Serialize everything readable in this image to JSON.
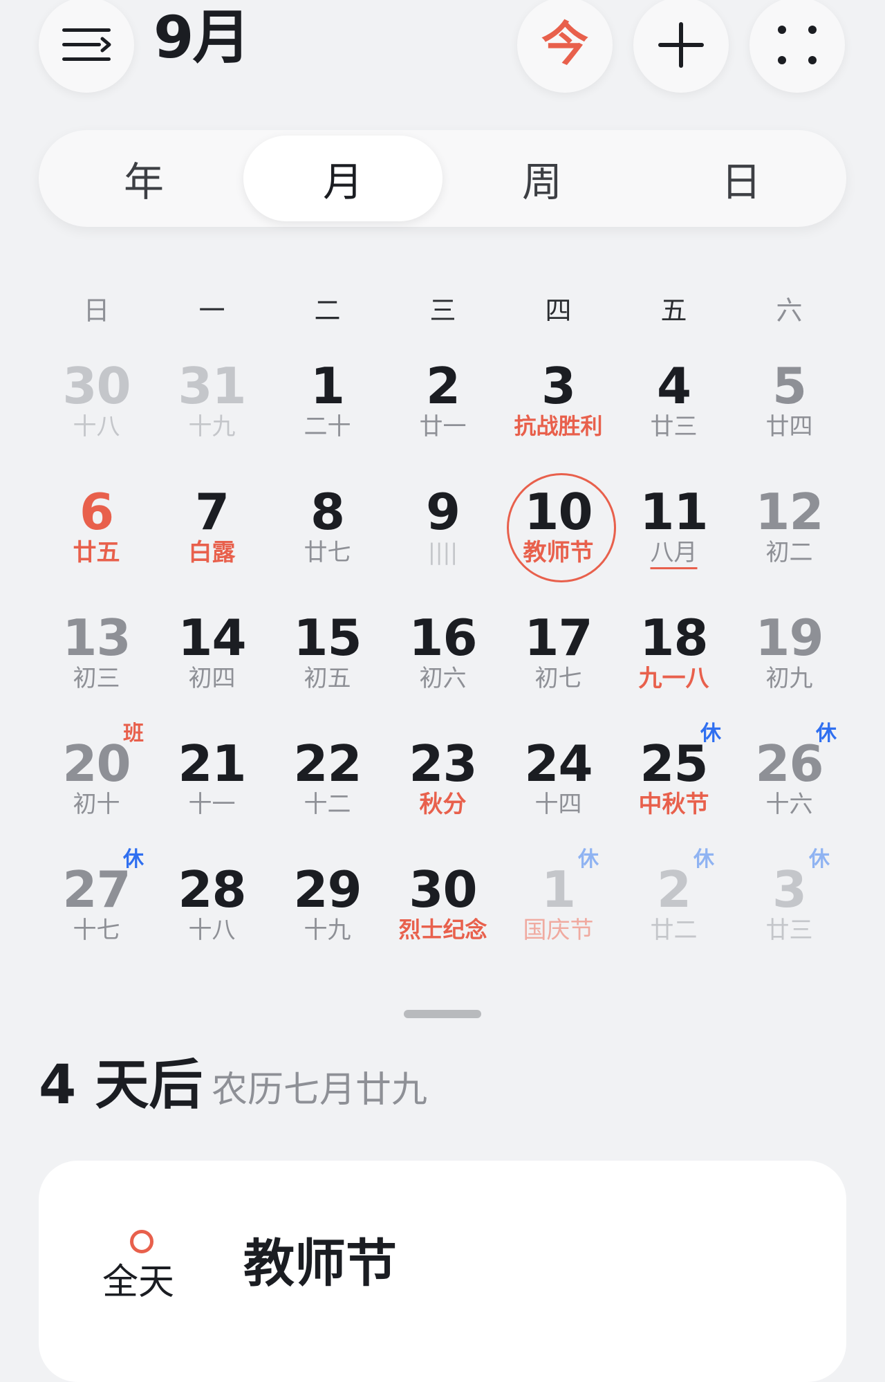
{
  "header": {
    "month_title": "9月",
    "today_button": "今"
  },
  "view_tabs": [
    {
      "label": "年",
      "active": false
    },
    {
      "label": "月",
      "active": true
    },
    {
      "label": "周",
      "active": false
    },
    {
      "label": "日",
      "active": false
    }
  ],
  "weekdays": [
    "日",
    "一",
    "二",
    "三",
    "四",
    "五",
    "六"
  ],
  "colors": {
    "accent_red": "#e8604c",
    "holiday_blue": "#2f6ff0",
    "text_dark": "#1b1d22",
    "text_gray": "#8e9096",
    "text_faded": "#c4c6ca"
  },
  "calendar_rows": [
    [
      {
        "day": "30",
        "sub": "十八",
        "state": "faded"
      },
      {
        "day": "31",
        "sub": "十九",
        "state": "faded"
      },
      {
        "day": "1",
        "sub": "二十",
        "state": "normal"
      },
      {
        "day": "2",
        "sub": "廿一",
        "state": "normal"
      },
      {
        "day": "3",
        "sub": "抗战胜利",
        "state": "normal",
        "sub_red": true
      },
      {
        "day": "4",
        "sub": "廿三",
        "state": "normal"
      },
      {
        "day": "5",
        "sub": "廿四",
        "state": "weekend"
      }
    ],
    [
      {
        "day": "6",
        "sub": "廿五",
        "state": "red",
        "sub_red": true
      },
      {
        "day": "7",
        "sub": "白露",
        "state": "normal",
        "sub_red": true
      },
      {
        "day": "8",
        "sub": "廿七",
        "state": "normal"
      },
      {
        "day": "9",
        "sub": "||||",
        "state": "normal",
        "sub_faded": true
      },
      {
        "day": "10",
        "sub": "教师节",
        "state": "today",
        "sub_red": true
      },
      {
        "day": "11",
        "sub": "八月",
        "state": "normal",
        "underline": true
      },
      {
        "day": "12",
        "sub": "初二",
        "state": "weekend"
      }
    ],
    [
      {
        "day": "13",
        "sub": "初三",
        "state": "weekend"
      },
      {
        "day": "14",
        "sub": "初四",
        "state": "normal"
      },
      {
        "day": "15",
        "sub": "初五",
        "state": "normal"
      },
      {
        "day": "16",
        "sub": "初六",
        "state": "normal"
      },
      {
        "day": "17",
        "sub": "初七",
        "state": "normal"
      },
      {
        "day": "18",
        "sub": "九一八",
        "state": "normal",
        "sub_red": true
      },
      {
        "day": "19",
        "sub": "初九",
        "state": "weekend"
      }
    ],
    [
      {
        "day": "20",
        "sub": "初十",
        "state": "weekend",
        "badge": "班",
        "badge_color": "red"
      },
      {
        "day": "21",
        "sub": "十一",
        "state": "normal"
      },
      {
        "day": "22",
        "sub": "十二",
        "state": "normal"
      },
      {
        "day": "23",
        "sub": "秋分",
        "state": "normal",
        "sub_red": true
      },
      {
        "day": "24",
        "sub": "十四",
        "state": "normal"
      },
      {
        "day": "25",
        "sub": "中秋节",
        "state": "normal",
        "sub_red": true,
        "badge": "休",
        "badge_color": "blue"
      },
      {
        "day": "26",
        "sub": "十六",
        "state": "weekend",
        "badge": "休",
        "badge_color": "blue"
      }
    ],
    [
      {
        "day": "27",
        "sub": "十七",
        "state": "weekend",
        "badge": "休",
        "badge_color": "blue"
      },
      {
        "day": "28",
        "sub": "十八",
        "state": "normal"
      },
      {
        "day": "29",
        "sub": "十九",
        "state": "normal"
      },
      {
        "day": "30",
        "sub": "烈士纪念",
        "state": "normal",
        "sub_red": true
      },
      {
        "day": "1",
        "sub": "国庆节",
        "state": "faded",
        "sub_red_faded": true,
        "badge": "休",
        "badge_color": "blue-faded"
      },
      {
        "day": "2",
        "sub": "廿二",
        "state": "faded",
        "badge": "休",
        "badge_color": "blue-faded"
      },
      {
        "day": "3",
        "sub": "廿三",
        "state": "faded",
        "badge": "休",
        "badge_color": "blue-faded"
      }
    ]
  ],
  "summary": {
    "countdown": "4 天后",
    "lunar_date": "农历七月廿九"
  },
  "event": {
    "time_label": "全天",
    "title": "教师节"
  }
}
